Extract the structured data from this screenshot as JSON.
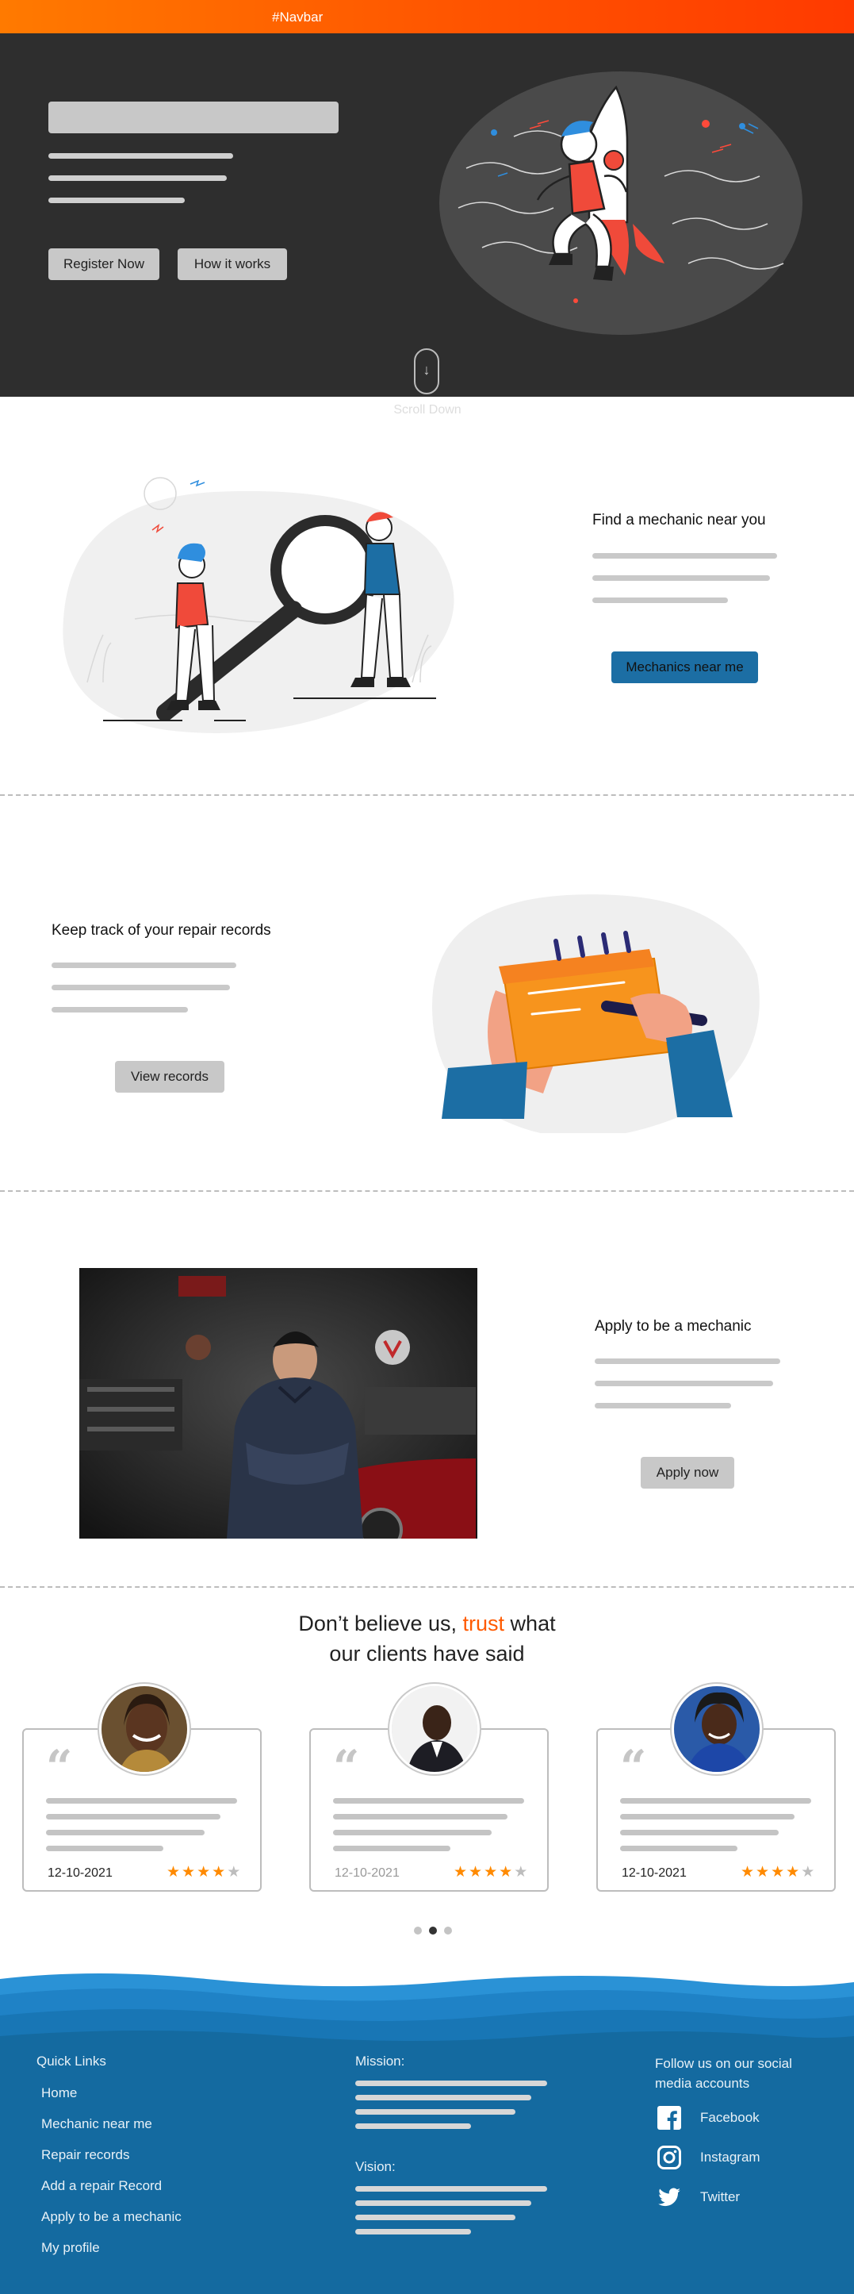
{
  "navbar": {
    "brand": "#Navbar"
  },
  "hero": {
    "buttons": {
      "register": "Register Now",
      "how_it_works": "How it works"
    },
    "scroll_label": "Scroll Down",
    "scroll_icon": "arrow-down-icon"
  },
  "sections": {
    "find": {
      "title": "Find a mechanic near you",
      "button": "Mechanics near me"
    },
    "records": {
      "title": "Keep track of your repair records",
      "button": "View records"
    },
    "apply": {
      "title": "Apply to be a mechanic",
      "button": "Apply now"
    }
  },
  "testimonials": {
    "heading_before": "Don’t believe us, ",
    "heading_accent": "trust",
    "heading_after": " what",
    "heading_line2": "our clients have said",
    "cards": [
      {
        "date": "12-10-2021",
        "rating": 4,
        "max": 5
      },
      {
        "date": "12-10-2021",
        "rating": 4,
        "max": 5
      },
      {
        "date": "12-10-2021",
        "rating": 4,
        "max": 5
      }
    ],
    "carousel": {
      "pages": 3,
      "active": 2
    }
  },
  "footer": {
    "quick_links_title": "Quick Links",
    "links": [
      "Home",
      "Mechanic near me",
      "Repair records",
      "Add a repair Record",
      "Apply to be a mechanic",
      "My profile"
    ],
    "mission_title": "Mission:",
    "vision_title": "Vision:",
    "social_title_1": "Follow us on our social",
    "social_title_2": "media accounts",
    "social": [
      {
        "label": "Facebook",
        "icon": "facebook-icon"
      },
      {
        "label": "Instagram",
        "icon": "instagram-icon"
      },
      {
        "label": "Twitter",
        "icon": "twitter-icon"
      }
    ]
  },
  "colors": {
    "nav_gradient_start": "#ff7a00",
    "nav_gradient_end": "#ff3a00",
    "hero_bg": "#2e2e2e",
    "accent": "#ff5a00",
    "blue_button": "#1c6ea4",
    "footer_bg": "#146aa0",
    "star": "#ff8a00"
  }
}
